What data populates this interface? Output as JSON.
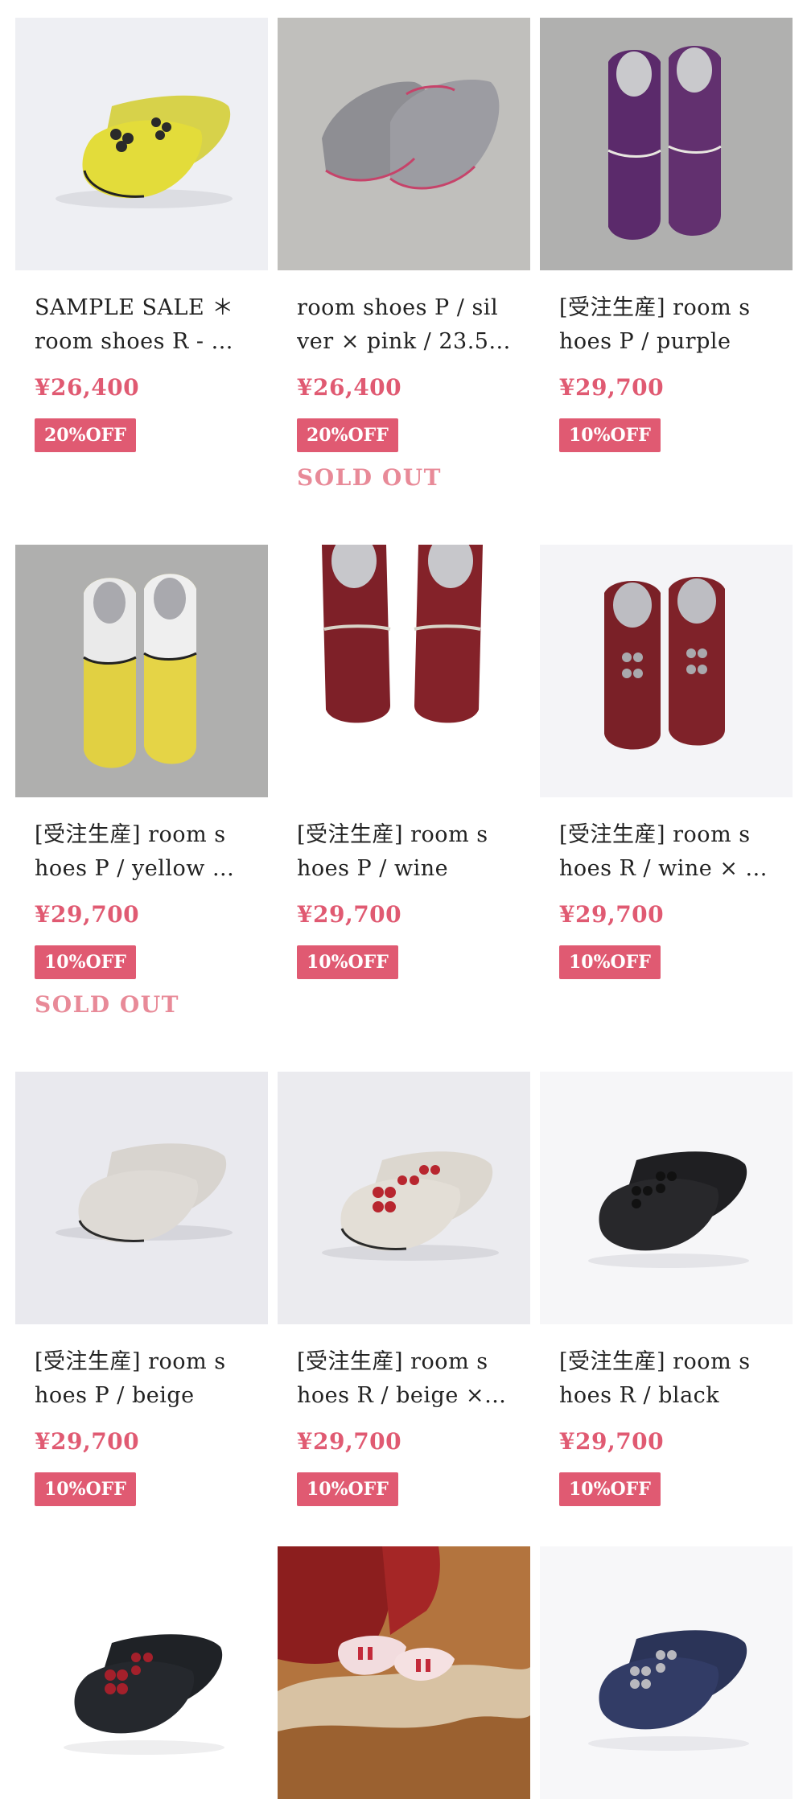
{
  "colors": {
    "accent": "#e05a72",
    "soldout": "#e88a98"
  },
  "products": [
    {
      "title_l1": "SAMPLE SALE ＊",
      "title_l2": "room shoes R - ...",
      "price": "¥26,400",
      "badge": "20%OFF",
      "soldout": "",
      "image": "yellow-mule-black-frogs"
    },
    {
      "title_l1": "room shoes P / sil",
      "title_l2": "ver × pink / 23.5...",
      "price": "¥26,400",
      "badge": "20%OFF",
      "soldout": "SOLD OUT",
      "image": "silver-mule-pink-trim"
    },
    {
      "title_l1": "[受注生産] room s",
      "title_l2": "hoes P / purple",
      "price": "¥29,700",
      "badge": "10%OFF",
      "soldout": "",
      "image": "purple-mule"
    },
    {
      "title_l1": "[受注生産] room s",
      "title_l2": "hoes P / yellow ...",
      "price": "¥29,700",
      "badge": "10%OFF",
      "soldout": "SOLD OUT",
      "image": "yellow-white-mule"
    },
    {
      "title_l1": "[受注生産] room s",
      "title_l2": "hoes P / wine",
      "price": "¥29,700",
      "badge": "10%OFF",
      "soldout": "",
      "image": "wine-mule"
    },
    {
      "title_l1": "[受注生産] room s",
      "title_l2": "hoes R / wine × ...",
      "price": "¥29,700",
      "badge": "10%OFF",
      "soldout": "",
      "image": "wine-mule-silver-frogs"
    },
    {
      "title_l1": "[受注生産] room s",
      "title_l2": "hoes P / beige",
      "price": "¥29,700",
      "badge": "10%OFF",
      "soldout": "",
      "image": "beige-mule"
    },
    {
      "title_l1": "[受注生産] room s",
      "title_l2": "hoes R / beige × ...",
      "price": "¥29,700",
      "badge": "10%OFF",
      "soldout": "",
      "image": "beige-mule-red-frogs"
    },
    {
      "title_l1": "[受注生産] room s",
      "title_l2": "hoes R / black",
      "price": "¥29,700",
      "badge": "10%OFF",
      "soldout": "",
      "image": "black-mule-black-frogs"
    },
    {
      "title_l1": "",
      "title_l2": "",
      "price": "",
      "badge": "",
      "soldout": "",
      "image": "black-mule-red-frogs"
    },
    {
      "title_l1": "",
      "title_l2": "",
      "price": "",
      "badge": "",
      "soldout": "",
      "image": "pink-shoes-on-rug"
    },
    {
      "title_l1": "",
      "title_l2": "",
      "price": "",
      "badge": "",
      "soldout": "",
      "image": "navy-mule-silver-frogs"
    }
  ]
}
